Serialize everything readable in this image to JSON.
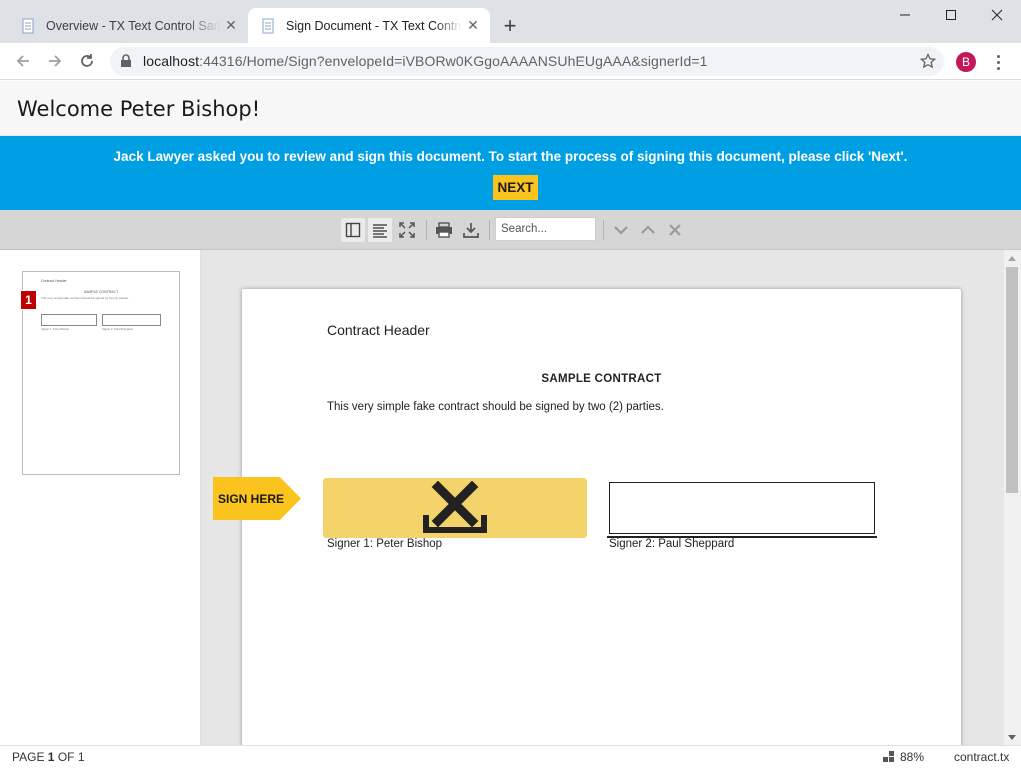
{
  "browser": {
    "tabs": [
      {
        "title": "Overview - TX Text Control Sample",
        "active": false
      },
      {
        "title": "Sign Document - TX Text Control Sample",
        "active": true
      }
    ],
    "url_host": "localhost",
    "url_rest": ":44316/Home/Sign?envelopeId=iVBORw0KGgoAAAANSUhEUgAAA&signerId=1",
    "profile_initial": "B"
  },
  "header": {
    "welcome": "Welcome Peter Bishop!"
  },
  "banner": {
    "message": "Jack Lawyer asked you to review and sign this document. To start the process of signing this document, please click 'Next'.",
    "next_label": "NEXT",
    "color": "#009fe3",
    "button_color": "#fbc31d"
  },
  "viewer_toolbar": {
    "search_placeholder": "Search..."
  },
  "sidebar": {
    "page_badge": "1",
    "thumbnail": {
      "header": "Contract Header",
      "title": "SAMPLE CONTRACT",
      "body": "This very simple fake contract should be signed by two (2) parties.",
      "signer1": "Signer 1: Peter Bishop",
      "signer2": "Signer 2: Paul Sheppard"
    }
  },
  "document": {
    "header": "Contract Header",
    "title": "SAMPLE CONTRACT",
    "body": "This very simple fake contract should be signed by two (2) parties.",
    "signer1_label": "Signer 1: Peter Bishop",
    "signer2_label": "Signer 2: Paul Sheppard",
    "sign_here": "SIGN HERE",
    "signature_box_color": "#f4d36b"
  },
  "statusbar": {
    "page_prefix": "PAGE ",
    "page_current": "1",
    "page_suffix": " OF 1",
    "zoom": "88%",
    "filename": "contract.tx"
  }
}
